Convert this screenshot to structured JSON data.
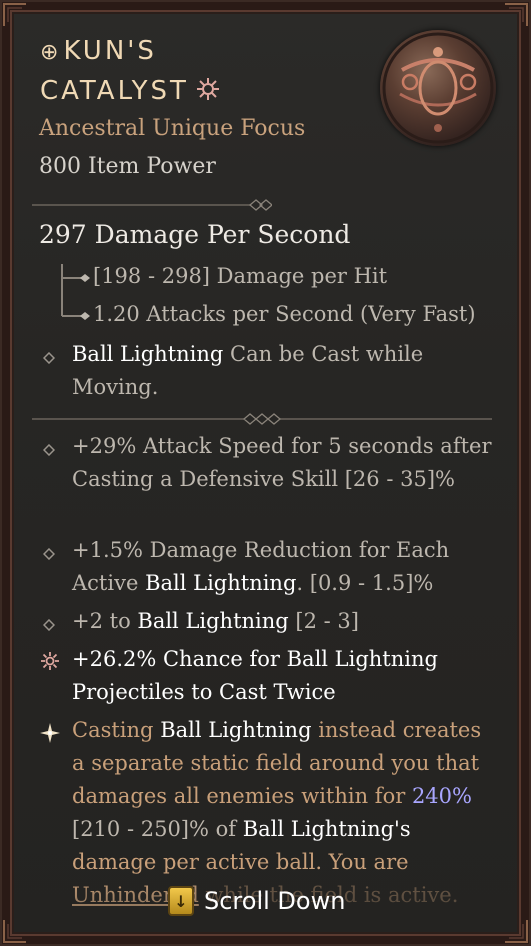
{
  "item": {
    "title_line1": "KUN'S",
    "title_line2": "CATALYST",
    "title_glyph": "⊕",
    "subtitle": "Ancestral Unique Focus",
    "item_power": "800 Item Power",
    "icon": "orb-focus-icon"
  },
  "stats": {
    "dps": "297 Damage Per Second",
    "damage_per_hit": "[198 - 298] Damage per Hit",
    "attacks_per_second": "1.20 Attacks per Second (Very Fast)"
  },
  "implicit": {
    "skill": "Ball Lightning",
    "rest": " Can be Cast while Moving."
  },
  "affixes": {
    "a1": "+29% Attack Speed for 5 seconds after Casting a Defensive Skill [26 - 35]%",
    "a2_pre": "+1.5% Damage Reduction for Each Active ",
    "a2_skill": "Ball Lightning",
    "a2_post": ". [0.9 - 1.5]%",
    "a3_pre": "+2 to ",
    "a3_skill": "Ball Lightning",
    "a3_post": " [2 - 3]",
    "a4": "+26.2% Chance for Ball Lightning Projectiles to Cast Twice"
  },
  "unique_power": {
    "p1": "Casting",
    "p2": "Ball Lightning",
    "p3": " instead creates a separate static field around you that damages all enemies within for ",
    "p4": "240%",
    "p5": " [210 - 250]% of ",
    "p6": "Ball Lightning's",
    "p7": " damage per active ball. You are ",
    "p8": "Unhindered",
    "p9": " while the field is active."
  },
  "controls": {
    "scroll_label": "Scroll Down",
    "scroll_key": "↓"
  },
  "colors": {
    "title": "#f0d9b5",
    "legendary_text": "#c9a07a",
    "highlight_number": "#a9a6ff",
    "frame": "#5a3a30"
  }
}
